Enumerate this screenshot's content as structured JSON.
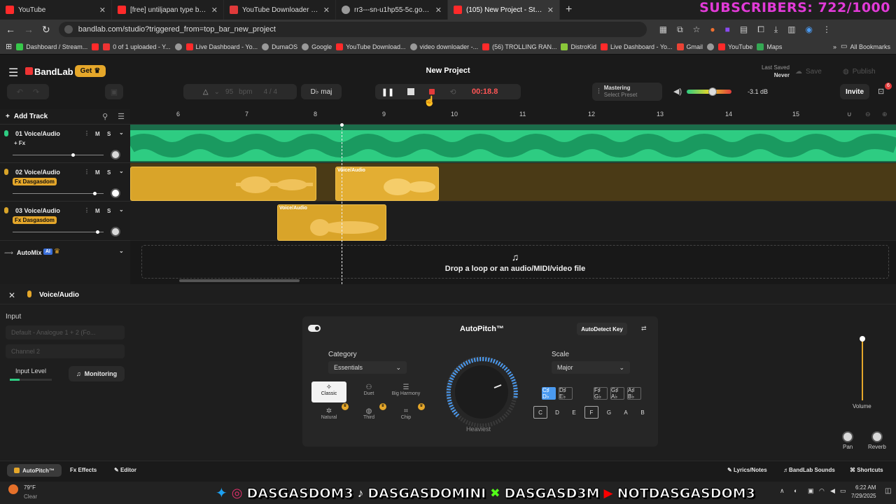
{
  "browser": {
    "tabs": [
      {
        "title": "YouTube",
        "active": false
      },
      {
        "title": "[free] untiljapan type beat *high",
        "active": false
      },
      {
        "title": "YouTube Downloader - Downlo",
        "active": false
      },
      {
        "title": "rr3---sn-u1hp55-5c.googlevide",
        "active": false
      },
      {
        "title": "(105) New Project - Studio",
        "active": true
      }
    ],
    "overlay_subscribers": "SUBSCRIBERS: 722/1000",
    "url": "bandlab.com/studio?triggered_from=top_bar_new_project",
    "bookmarks": [
      "Dashboard / Stream...",
      "",
      "0 of 1 uploaded - Y...",
      "",
      "Live Dashboard - Yo...",
      "DumaOS",
      "Google",
      "YouTube Download...",
      "video downloader -...",
      "(56) TROLLING RAN...",
      "DistroKid",
      "Live Dashboard - Yo...",
      "Gmail",
      "",
      "YouTube",
      "Maps"
    ],
    "all_bookmarks": "All Bookmarks"
  },
  "app": {
    "brand": "BandLab",
    "get_label": "Get",
    "project_title": "New Project",
    "last_saved_label": "Last Saved",
    "last_saved_value": "Never",
    "save_label": "Save",
    "publish_label": "Publish",
    "bpm_value": "95",
    "bpm_unit": "bpm",
    "time_sig": "4 / 4",
    "key_label": "D♭ maj",
    "time": "00:18.8",
    "mastering_label": "Mastering",
    "mastering_sub": "Select Preset",
    "volume_db": "-3.1 dB",
    "invite_label": "Invite",
    "cart_badge": "6",
    "add_track_label": "Add Track"
  },
  "ruler": [
    "6",
    "7",
    "8",
    "9",
    "10",
    "11",
    "12",
    "13",
    "14",
    "15"
  ],
  "tracks": [
    {
      "name": "01 Voice/Audio",
      "fx": "+ Fx",
      "fx_style": "plain",
      "m": "M",
      "s": "S",
      "color": "#2ecc82",
      "volume": 0.8
    },
    {
      "name": "02 Voice/Audio",
      "fx": "Fx Dasgasdom",
      "fx_style": "tag",
      "m": "M",
      "s": "S",
      "color": "#d9a429",
      "volume": 0.98
    },
    {
      "name": "03 Voice/Audio",
      "fx": "Fx Dasgasdom",
      "fx_style": "tag",
      "m": "M",
      "s": "S",
      "color": "#d9a429",
      "volume": 1.0
    }
  ],
  "clip_labels": {
    "track2_second": "Voice/Audio",
    "track3": "Voice/Audio"
  },
  "automix": {
    "label": "AutoMix",
    "badge": "AI"
  },
  "drop_zone": "Drop a loop or an audio/MIDI/video file",
  "panel": {
    "title": "Voice/Audio",
    "input_label": "Input",
    "input_device": "Default - Analogue 1 + 2 (Fo...",
    "channel": "Channel 2",
    "input_level_label": "Input Level",
    "monitoring_label": "Monitoring",
    "autopitch_title": "AutoPitch™",
    "autodetect_label": "AutoDetect Key",
    "category_label": "Category",
    "category_value": "Essentials",
    "presets": [
      "Classic",
      "Duet",
      "Big Harmony",
      "Natural",
      "Third",
      "Chip"
    ],
    "dial_label": "Heaviest",
    "scale_label": "Scale",
    "scale_value": "Major",
    "sharps": [
      "C♯ D♭",
      "D♯ E♭",
      "F♯ G♭",
      "G♯ A♭",
      "A♯ B♭"
    ],
    "naturals": [
      "C",
      "D",
      "E",
      "F",
      "G",
      "A",
      "B"
    ],
    "volume_label": "Volume",
    "pan_label": "Pan",
    "reverb_label": "Reverb"
  },
  "footer": {
    "tabs": [
      "AutoPitch™",
      "Fx  Effects",
      "Editor"
    ],
    "right": [
      "Lyrics/Notes",
      "BandLab Sounds",
      "Shortcuts"
    ]
  },
  "taskbar": {
    "temp": "79°F",
    "weather": "Clear",
    "time": "6:22 AM",
    "date": "7/29/2025",
    "socials": [
      "DASGASDOM3",
      "DASGASDOMINI",
      "DASGASD3M",
      "NOTDASGASDOM3"
    ]
  },
  "colors": {
    "accent_green": "#2ecc82",
    "accent_yellow": "#d9a429",
    "record_red": "#e23b3b",
    "time_red": "#ff5555",
    "overlay_magenta": "#e23ad8"
  }
}
